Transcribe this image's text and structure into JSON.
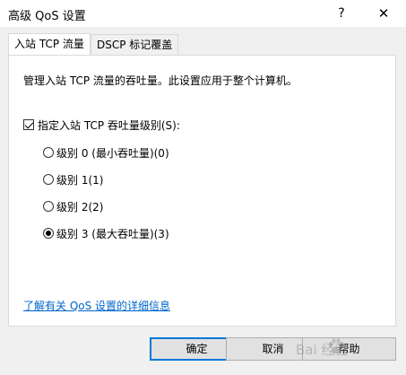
{
  "window": {
    "title": "高级 QoS 设置",
    "help_glyph": "?",
    "close_glyph": "✕"
  },
  "tabs": [
    {
      "label": "入站 TCP 流量",
      "active": true
    },
    {
      "label": "DSCP 标记覆盖",
      "active": false
    }
  ],
  "panel": {
    "description": "管理入站 TCP 流量的吞吐量。此设置应用于整个计算机。",
    "checkbox": {
      "label": "指定入站 TCP 吞吐量级别(S):",
      "checked": true
    },
    "radios": [
      {
        "label": "级别 0 (最小吞吐量)(0)",
        "selected": false
      },
      {
        "label": "级别 1(1)",
        "selected": false
      },
      {
        "label": "级别 2(2)",
        "selected": false
      },
      {
        "label": "级别 3 (最大吞吐量)(3)",
        "selected": true
      }
    ],
    "link": "了解有关 QoS 设置的详细信息"
  },
  "buttons": {
    "ok": "确定",
    "cancel": "取消",
    "help": "帮助"
  },
  "watermark": "Bai 经验",
  "colors": {
    "accent": "#0078d7",
    "link": "#0066cc"
  }
}
